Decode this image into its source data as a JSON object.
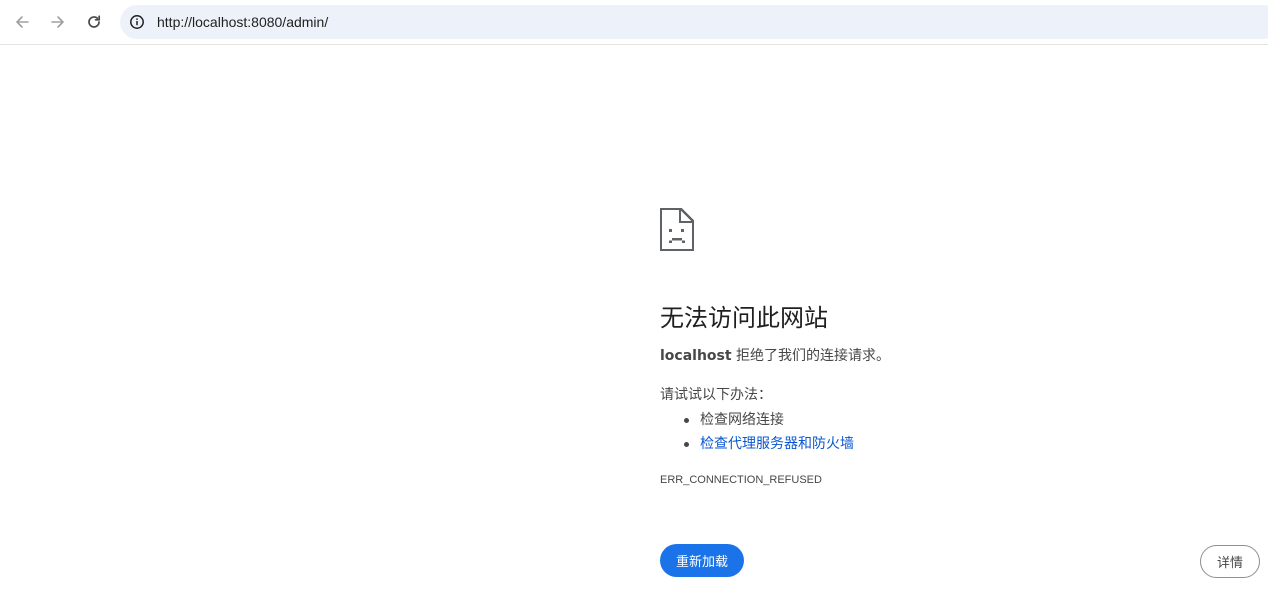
{
  "toolbar": {
    "back_icon": "arrow-left-icon",
    "forward_icon": "arrow-right-icon",
    "reload_icon": "reload-icon",
    "site_info_icon": "info-circle-icon",
    "url": "http://localhost:8080/admin/"
  },
  "error": {
    "icon": "sad-page-icon",
    "title": "无法访问此网站",
    "host": "localhost",
    "message": " 拒绝了我们的连接请求。",
    "suggest_heading": "请试试以下办法：",
    "suggestions": [
      {
        "text": "检查网络连接",
        "is_link": false
      },
      {
        "text": "检查代理服务器和防火墙",
        "is_link": true
      }
    ],
    "code": "ERR_CONNECTION_REFUSED"
  },
  "buttons": {
    "reload_label": "重新加载",
    "details_label": "详情"
  },
  "colors": {
    "accent": "#1a73e8",
    "link": "#0b57d0",
    "omnibox_bg": "#edf2fa",
    "text_secondary": "#474747"
  }
}
